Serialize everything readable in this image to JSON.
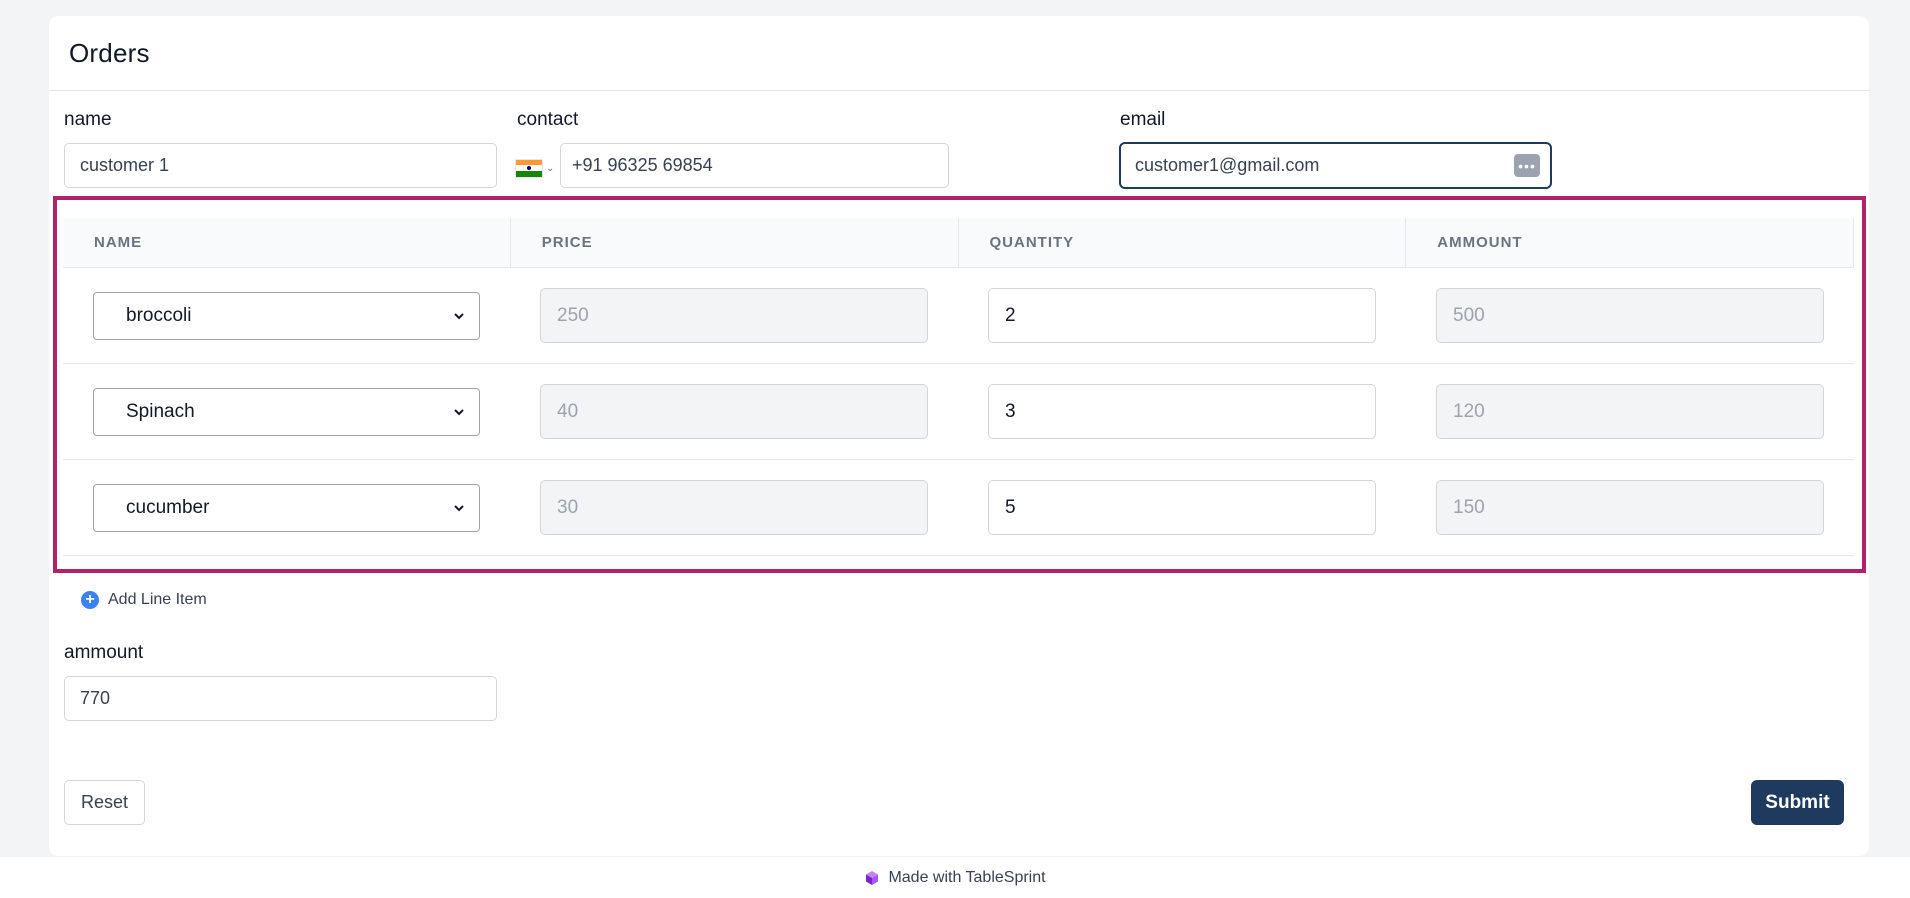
{
  "page": {
    "title": "Orders"
  },
  "form": {
    "name": {
      "label": "name",
      "value": "customer 1"
    },
    "contact": {
      "label": "contact",
      "value": "+91 96325 69854",
      "country_flag": "india-flag-icon"
    },
    "email": {
      "label": "email",
      "value": "customer1@gmail.com"
    },
    "ammount": {
      "label": "ammount",
      "value": "770"
    }
  },
  "line_items": {
    "columns": [
      "NAME",
      "PRICE",
      "QUANTITY",
      "AMMOUNT"
    ],
    "rows": [
      {
        "name": "broccoli",
        "price": "250",
        "quantity": "2",
        "ammount": "500"
      },
      {
        "name": "Spinach",
        "price": "40",
        "quantity": "3",
        "ammount": "120"
      },
      {
        "name": "cucumber",
        "price": "30",
        "quantity": "5",
        "ammount": "150"
      }
    ],
    "add_label": "Add Line Item"
  },
  "actions": {
    "reset_label": "Reset",
    "submit_label": "Submit"
  },
  "footer": {
    "text": "Made with TableSprint"
  },
  "colors": {
    "highlight": "#b0236a",
    "primary": "#1e3a5f",
    "accent": "#3b82f6"
  }
}
